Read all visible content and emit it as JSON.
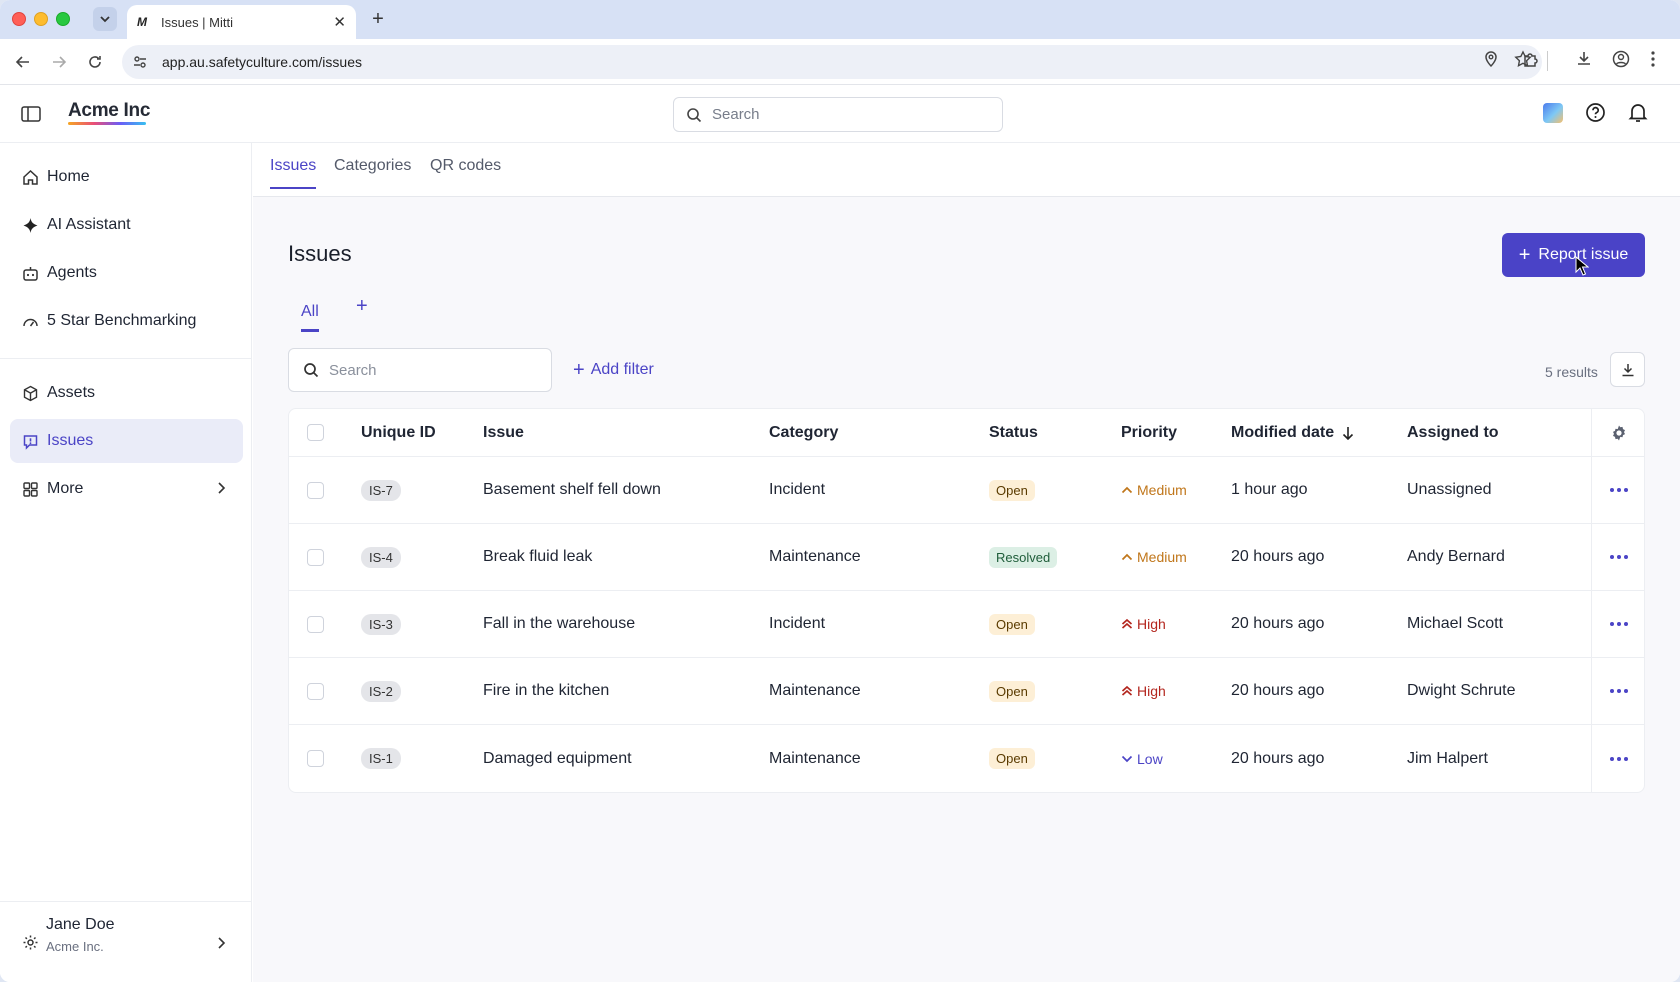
{
  "browser": {
    "tab_title": "Issues | Mitti",
    "tab_favicon": "M",
    "url": "app.au.safetyculture.com/issues"
  },
  "app": {
    "brand": "Acme Inc",
    "search_placeholder": "Search",
    "accent_color": "#4a43c7"
  },
  "sidebar": {
    "items": [
      {
        "label": "Home",
        "icon": "home-icon"
      },
      {
        "label": "AI Assistant",
        "icon": "sparkle-icon"
      },
      {
        "label": "Agents",
        "icon": "robot-icon"
      },
      {
        "label": "5 Star Benchmarking",
        "icon": "gauge-icon"
      },
      {
        "label": "Assets",
        "icon": "cube-icon"
      },
      {
        "label": "Issues",
        "icon": "alert-icon"
      },
      {
        "label": "More",
        "icon": "grid-icon"
      }
    ],
    "user": {
      "name": "Jane Doe",
      "org": "Acme Inc."
    }
  },
  "subtabs": [
    "Issues",
    "Categories",
    "QR codes"
  ],
  "page": {
    "title": "Issues",
    "report_button": "Report issue",
    "view_tab": "All",
    "view_add": "+",
    "search_placeholder": "Search",
    "add_filter": "Add filter",
    "results": "5 results"
  },
  "table": {
    "headers": {
      "id": "Unique ID",
      "issue": "Issue",
      "category": "Category",
      "status": "Status",
      "priority": "Priority",
      "modified": "Modified date",
      "assigned": "Assigned to"
    },
    "rows": [
      {
        "id": "IS-7",
        "issue": "Basement shelf fell down",
        "category": "Incident",
        "status": "Open",
        "priority": "Medium",
        "modified": "1 hour ago",
        "assigned": "Unassigned"
      },
      {
        "id": "IS-4",
        "issue": "Break fluid leak",
        "category": "Maintenance",
        "status": "Resolved",
        "priority": "Medium",
        "modified": "20 hours ago",
        "assigned": "Andy Bernard"
      },
      {
        "id": "IS-3",
        "issue": "Fall in the warehouse",
        "category": "Incident",
        "status": "Open",
        "priority": "High",
        "modified": "20 hours ago",
        "assigned": "Michael Scott"
      },
      {
        "id": "IS-2",
        "issue": "Fire in the kitchen",
        "category": "Maintenance",
        "status": "Open",
        "priority": "High",
        "modified": "20 hours ago",
        "assigned": "Dwight Schrute"
      },
      {
        "id": "IS-1",
        "issue": "Damaged equipment",
        "category": "Maintenance",
        "status": "Open",
        "priority": "Low",
        "modified": "20 hours ago",
        "assigned": "Jim Halpert"
      }
    ]
  }
}
